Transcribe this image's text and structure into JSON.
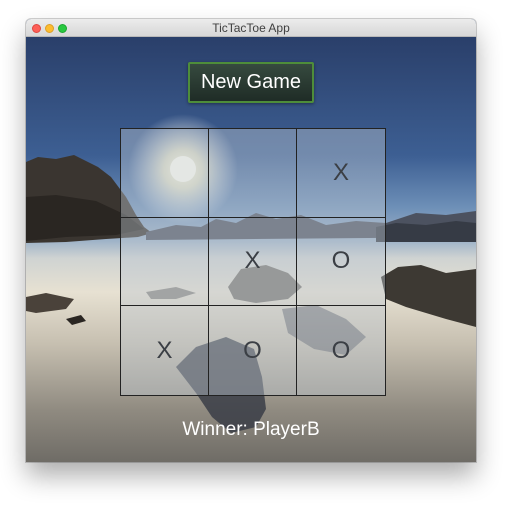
{
  "window": {
    "title": "TicTacToe App"
  },
  "toolbar": {
    "new_game_label": "New Game"
  },
  "board": {
    "cells": [
      "",
      "",
      "X",
      "",
      "X",
      "O",
      "X",
      "O",
      "O"
    ]
  },
  "status": {
    "winner_text": "Winner: PlayerB"
  },
  "colors": {
    "button_border": "#4e8d3a",
    "button_bg": "#2a3a32",
    "cell_overlay": "#bec8d2",
    "grid_line": "#222222",
    "mark_color": "#3b3f45"
  }
}
